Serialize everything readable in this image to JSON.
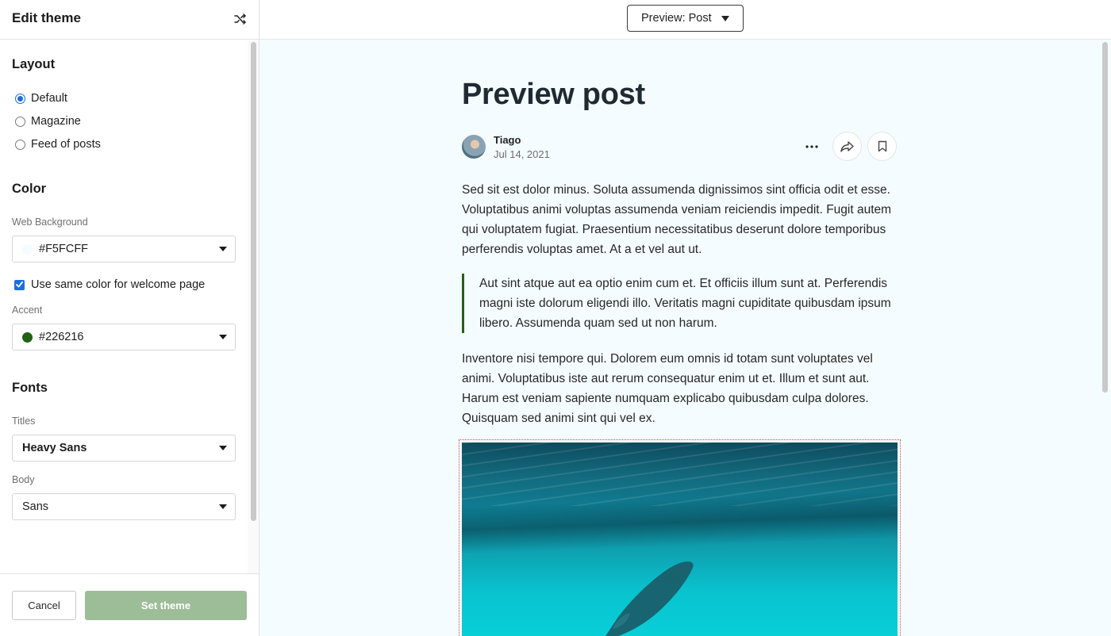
{
  "sidebar": {
    "title": "Edit theme",
    "layout": {
      "heading": "Layout",
      "options": [
        {
          "label": "Default",
          "selected": true
        },
        {
          "label": "Magazine",
          "selected": false
        },
        {
          "label": "Feed of posts",
          "selected": false
        }
      ]
    },
    "color": {
      "heading": "Color",
      "web_background_label": "Web Background",
      "web_background_value": "#F5FCFF",
      "web_background_swatch": "#F5FCFF",
      "same_color_label": "Use same color for welcome page",
      "same_color_checked": true,
      "accent_label": "Accent",
      "accent_value": "#226216",
      "accent_swatch": "#226216"
    },
    "fonts": {
      "heading": "Fonts",
      "titles_label": "Titles",
      "titles_value": "Heavy Sans",
      "body_label": "Body",
      "body_value": "Sans"
    },
    "footer": {
      "cancel_label": "Cancel",
      "set_theme_label": "Set theme"
    }
  },
  "main": {
    "preview_select": "Preview: Post",
    "post": {
      "title": "Preview post",
      "author": "Tiago",
      "date": "Jul 14, 2021",
      "paragraph1": "Sed sit est dolor minus. Soluta assumenda dignissimos sint officia odit et esse. Voluptatibus animi voluptas assumenda veniam reiciendis impedit. Fugit autem qui voluptatem fugiat. Praesentium necessitatibus deserunt dolore temporibus perferendis voluptas amet. At a et vel aut ut.",
      "quote": "Aut sint atque aut ea optio enim cum et. Et officiis illum sunt at. Perferendis magni iste dolorum eligendi illo. Veritatis magni cupiditate quibusdam ipsum libero. Assumenda quam sed ut non harum.",
      "paragraph2": "Inventore nisi tempore qui. Dolorem eum omnis id totam sunt voluptates vel animi. Voluptatibus iste aut rerum consequatur enim ut et. Illum et sunt aut. Harum est veniam sapiente numquam explicabo quibusdam culpa dolores. Quisquam sed animi sint qui vel ex."
    },
    "background_color": "#F5FCFF"
  },
  "icons": {
    "shuffle": "shuffle-icon",
    "more": "more-horizontal-icon",
    "share": "share-icon",
    "bookmark": "bookmark-icon",
    "caret": "caret-down-icon"
  }
}
